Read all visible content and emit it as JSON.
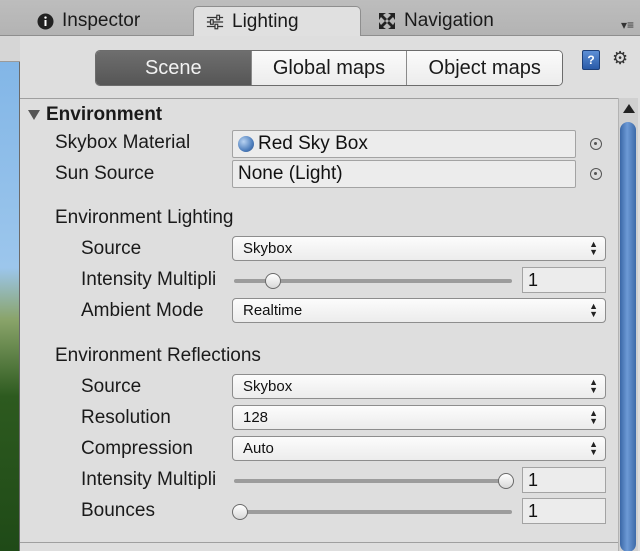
{
  "tabs": [
    {
      "label": "Inspector",
      "icon": "info-icon",
      "active": false
    },
    {
      "label": "Lighting",
      "icon": "sliders-icon",
      "active": true
    },
    {
      "label": "Navigation",
      "icon": "navigation-icon",
      "active": false
    }
  ],
  "mode_buttons": [
    {
      "label": "Scene",
      "active": true
    },
    {
      "label": "Global maps",
      "active": false
    },
    {
      "label": "Object maps",
      "active": false
    }
  ],
  "environment": {
    "header": "Environment",
    "skybox_material": {
      "label": "Skybox Material",
      "value": "Red Sky Box"
    },
    "sun_source": {
      "label": "Sun Source",
      "value": "None (Light)"
    },
    "lighting": {
      "header": "Environment Lighting",
      "source": {
        "label": "Source",
        "value": "Skybox"
      },
      "intensity": {
        "label": "Intensity Multipli",
        "value": "1",
        "slider_fraction": 0.125
      },
      "ambient_mode": {
        "label": "Ambient Mode",
        "value": "Realtime"
      }
    },
    "reflections": {
      "header": "Environment Reflections",
      "source": {
        "label": "Source",
        "value": "Skybox"
      },
      "resolution": {
        "label": "Resolution",
        "value": "128"
      },
      "compression": {
        "label": "Compression",
        "value": "Auto"
      },
      "intensity": {
        "label": "Intensity Multipli",
        "value": "1",
        "slider_fraction": 1.0
      },
      "bounces": {
        "label": "Bounces",
        "value": "1",
        "slider_fraction": 0.0
      }
    }
  }
}
